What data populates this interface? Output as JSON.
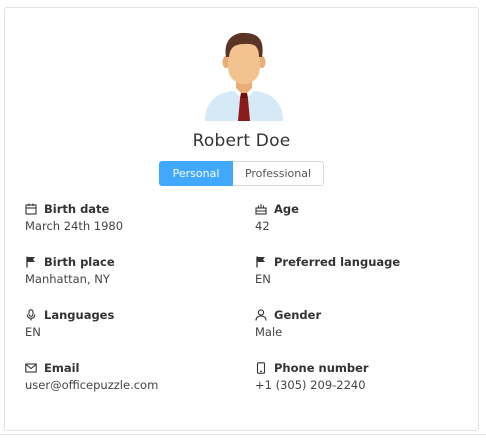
{
  "profile": {
    "name": "Robert Doe"
  },
  "tabs": [
    {
      "label": "Personal",
      "active": true
    },
    {
      "label": "Professional",
      "active": false
    }
  ],
  "fields": [
    {
      "label": "Birth date",
      "value": "March 24th 1980",
      "icon": "calendar-icon"
    },
    {
      "label": "Age",
      "value": "42",
      "icon": "cake-icon"
    },
    {
      "label": "Birth place",
      "value": "Manhattan, NY",
      "icon": "flag-icon"
    },
    {
      "label": "Preferred language",
      "value": "EN",
      "icon": "flag-icon"
    },
    {
      "label": "Languages",
      "value": "EN",
      "icon": "microphone-icon"
    },
    {
      "label": "Gender",
      "value": "Male",
      "icon": "user-icon"
    },
    {
      "label": "Email",
      "value": "user@officepuzzle.com",
      "icon": "mail-icon"
    },
    {
      "label": "Phone number",
      "value": "+1 (305) 209-2240",
      "icon": "phone-icon"
    }
  ],
  "colors": {
    "accent": "#40a9ff",
    "tie": "#8b1a1a",
    "shirt": "#d6e9f7",
    "skin": "#f3c38f",
    "hair": "#5a3424"
  }
}
